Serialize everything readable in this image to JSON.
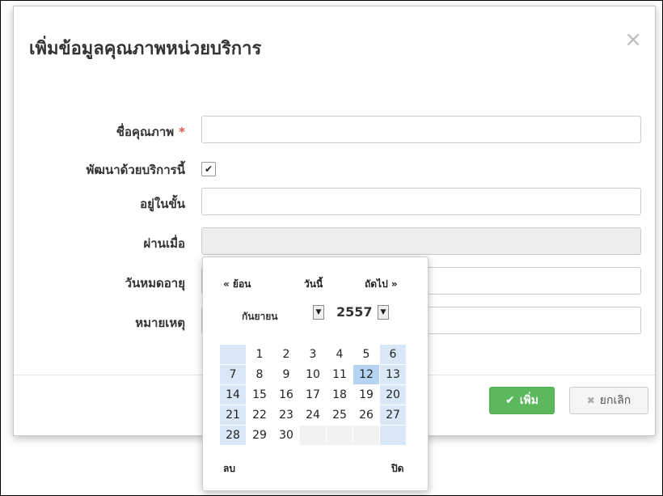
{
  "modal": {
    "title": "เพิ่มข้อมูลคุณภาพหน่วยบริการ",
    "close_glyph": "×"
  },
  "form": {
    "quality_name_label": "ชื่อคุณภาพ",
    "required_mark": "*",
    "quality_name_value": "",
    "developed_label": "พัฒนาด้วยบริการนี้",
    "developed_checked": true,
    "check_glyph": "✔",
    "level_label": "อยู่ในขั้น",
    "level_value": "",
    "passed_label": "ผ่านเมื่อ",
    "passed_value": "",
    "expire_label": "วันหมดอายุ",
    "expire_value": "",
    "note_label": "หมายเหตุ",
    "note_value": ""
  },
  "footer": {
    "add_label": "เพิ่ม",
    "add_icon": "check-icon",
    "cancel_label": "ยกเลิก",
    "cancel_icon": "x-icon"
  },
  "calendar": {
    "prev_label": "« ย้อน",
    "today_label": "วันนี้",
    "next_label": "ถัดไป »",
    "month_label": "กันยายน",
    "year_label": "2557",
    "dropdown_glyph": "▼",
    "weeks": [
      [
        "",
        "1",
        "2",
        "3",
        "4",
        "5",
        "6"
      ],
      [
        "7",
        "8",
        "9",
        "10",
        "11",
        "12",
        "13"
      ],
      [
        "14",
        "15",
        "16",
        "17",
        "18",
        "19",
        "20"
      ],
      [
        "21",
        "22",
        "23",
        "24",
        "25",
        "26",
        "27"
      ],
      [
        "28",
        "29",
        "30",
        "",
        "",
        "",
        ""
      ]
    ],
    "selected_day": "12",
    "clear_label": "ลบ",
    "close_label": "ปิด"
  },
  "colors": {
    "add_button": "#5cb85c",
    "required": "#d9534f",
    "weekend_cell": "#d9e8f7",
    "selected_cell": "#b5d3f2"
  }
}
